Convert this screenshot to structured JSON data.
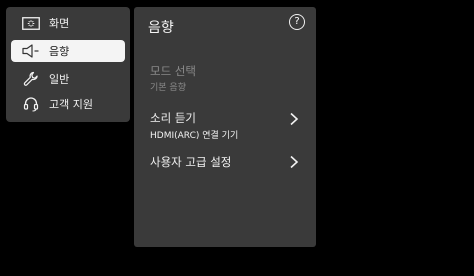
{
  "sidebar": {
    "items": [
      {
        "label": "화면",
        "icon": "screen-icon"
      },
      {
        "label": "음향",
        "icon": "speaker-icon",
        "active": true
      },
      {
        "label": "일반",
        "icon": "wrench-icon"
      },
      {
        "label": "고객 지원",
        "icon": "headset-icon"
      }
    ]
  },
  "panel": {
    "title": "음향",
    "help_label": "?",
    "rows": [
      {
        "label": "모드 선택",
        "sub": "기본 음향",
        "enabled": false
      },
      {
        "label": "소리 듣기",
        "sub": "HDMI(ARC) 연결 기기",
        "enabled": true
      },
      {
        "label": "사용자 고급 설정",
        "enabled": true
      }
    ]
  },
  "colors": {
    "background": "#000000",
    "panel": "#3a3a3a",
    "active_item": "#f4f4f4",
    "disabled_text": "#8a8a8a"
  }
}
